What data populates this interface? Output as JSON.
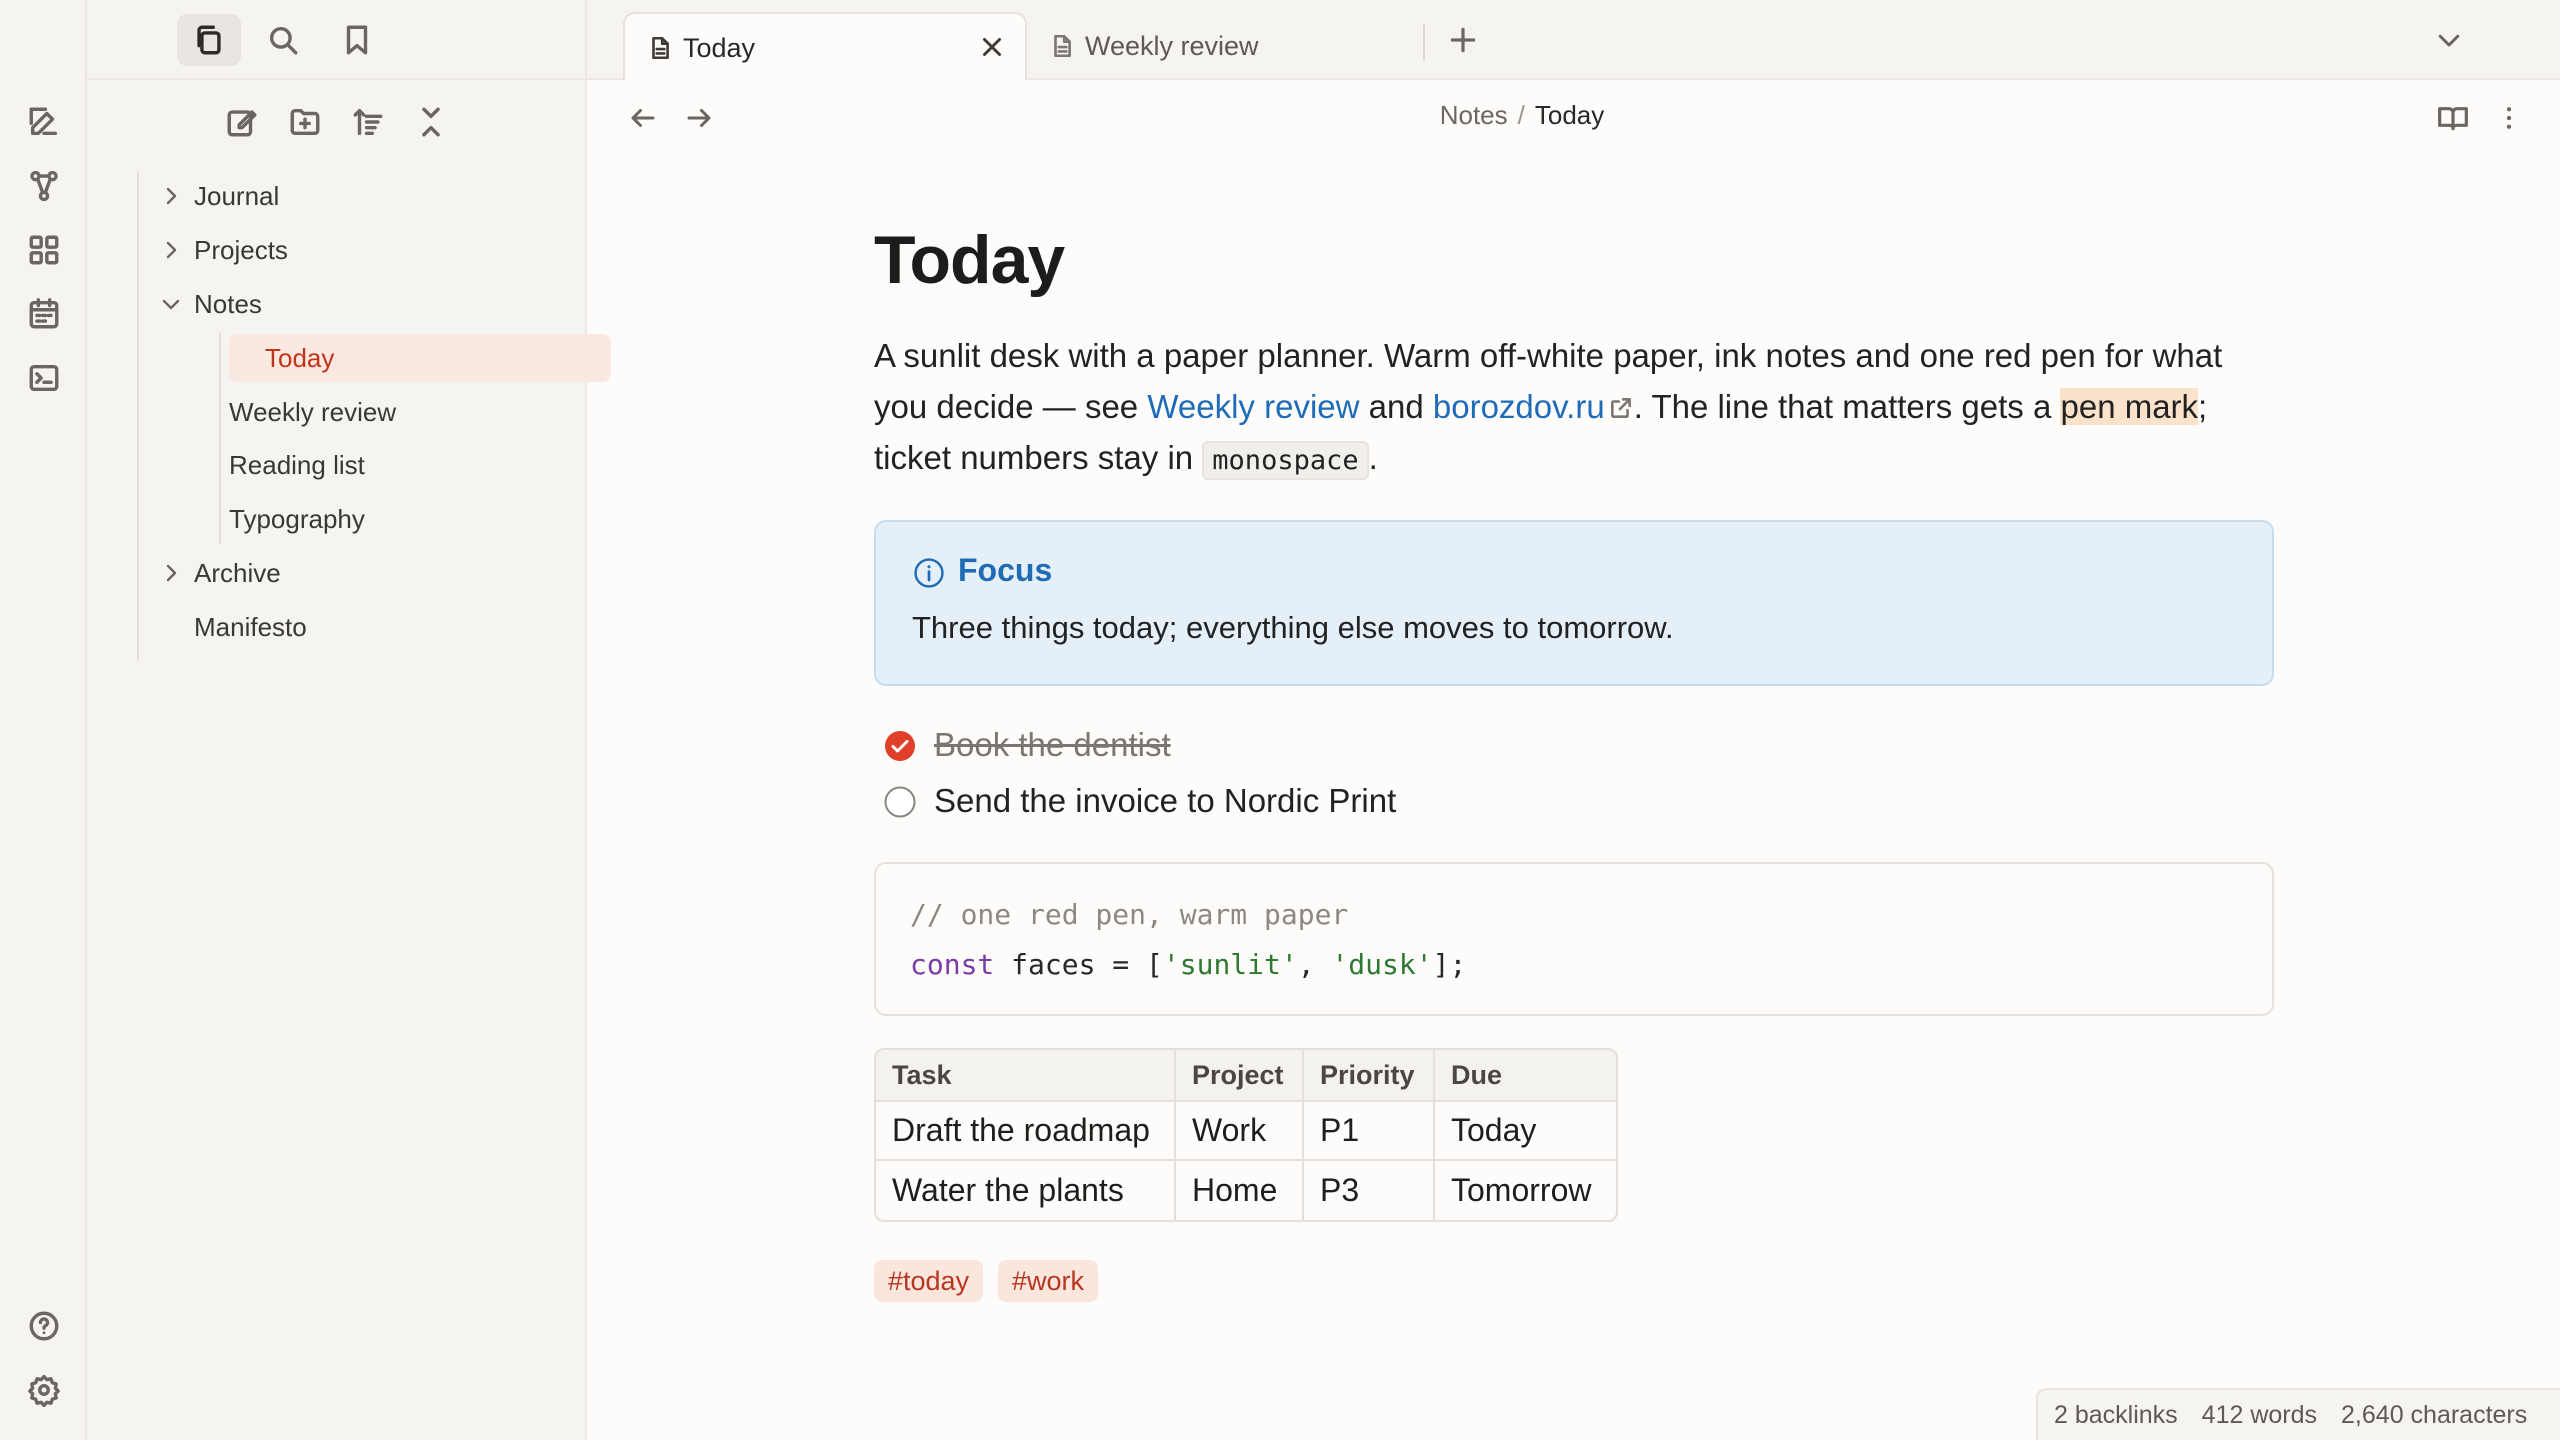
{
  "colors": {
    "accent": "#c2341c",
    "link": "#1e6bb8",
    "callout_bg": "#e5eff8",
    "highlight": "#fbe3cb",
    "check_done": "#e0402a"
  },
  "sidebar": {
    "tree": [
      {
        "label": "Journal",
        "type": "folder",
        "expanded": false
      },
      {
        "label": "Projects",
        "type": "folder",
        "expanded": false
      },
      {
        "label": "Notes",
        "type": "folder",
        "expanded": true,
        "children": [
          "Today",
          "Weekly review",
          "Reading list",
          "Typography"
        ],
        "selected": "Today"
      },
      {
        "label": "Archive",
        "type": "folder",
        "expanded": false
      },
      {
        "label": "Manifesto",
        "type": "file"
      }
    ]
  },
  "tabs": [
    {
      "label": "Today",
      "active": true
    },
    {
      "label": "Weekly review",
      "active": false
    }
  ],
  "breadcrumb": {
    "parent": "Notes",
    "separator": "/",
    "current": "Today"
  },
  "document": {
    "title": "Today",
    "paragraph": {
      "text1": "A sunlit desk with a paper planner. Warm off-white paper, ink notes and one red pen for what you decide — see ",
      "link1": "Weekly review",
      "text2": " and ",
      "link2": "borozdov.ru",
      "text3": ". The line that matters gets a ",
      "highlight": "pen mark",
      "text4": "; ticket numbers stay in ",
      "code": "monospace",
      "text5": "."
    },
    "callout": {
      "title": "Focus",
      "body": "Three things today; everything else moves to tomorrow."
    },
    "tasks": [
      {
        "label": "Book the dentist",
        "done": true
      },
      {
        "label": "Send the invoice to Nordic Print",
        "done": false
      }
    ],
    "code": {
      "comment": "// one red pen, warm paper",
      "kw": "const",
      "rest1": " faces = [",
      "s1": "'sunlit'",
      "comma": ", ",
      "s2": "'dusk'",
      "rest2": "];"
    },
    "table": {
      "headers": [
        "Task",
        "Project",
        "Priority",
        "Due"
      ],
      "rows": [
        [
          "Draft the roadmap",
          "Work",
          "P1",
          "Today"
        ],
        [
          "Water the plants",
          "Home",
          "P3",
          "Tomorrow"
        ]
      ]
    },
    "tags": [
      "#today",
      "#work"
    ]
  },
  "status": {
    "backlinks": "2 backlinks",
    "words": "412 words",
    "characters": "2,640 characters"
  }
}
